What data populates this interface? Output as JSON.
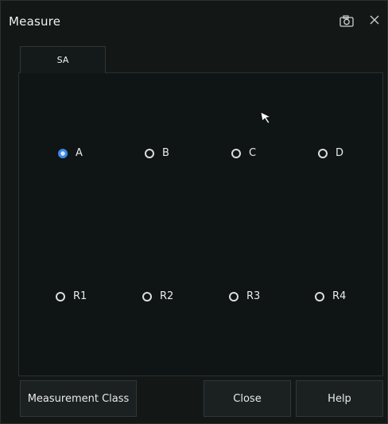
{
  "window": {
    "title": "Measure",
    "camera_icon": "camera-icon",
    "close_icon": "close-icon"
  },
  "tabs": [
    {
      "label": "SA",
      "active": true
    }
  ],
  "radios": {
    "row1": [
      {
        "label": "A",
        "checked": true
      },
      {
        "label": "B",
        "checked": false
      },
      {
        "label": "C",
        "checked": false
      },
      {
        "label": "D",
        "checked": false
      }
    ],
    "row2": [
      {
        "label": "R1",
        "checked": false
      },
      {
        "label": "R2",
        "checked": false
      },
      {
        "label": "R3",
        "checked": false
      },
      {
        "label": "R4",
        "checked": false
      }
    ]
  },
  "buttons": {
    "measurement_class": "Measurement Class",
    "close": "Close",
    "help": "Help"
  },
  "colors": {
    "background": "#131817",
    "panel": "#0f1414",
    "accent": "#3c86e6"
  }
}
